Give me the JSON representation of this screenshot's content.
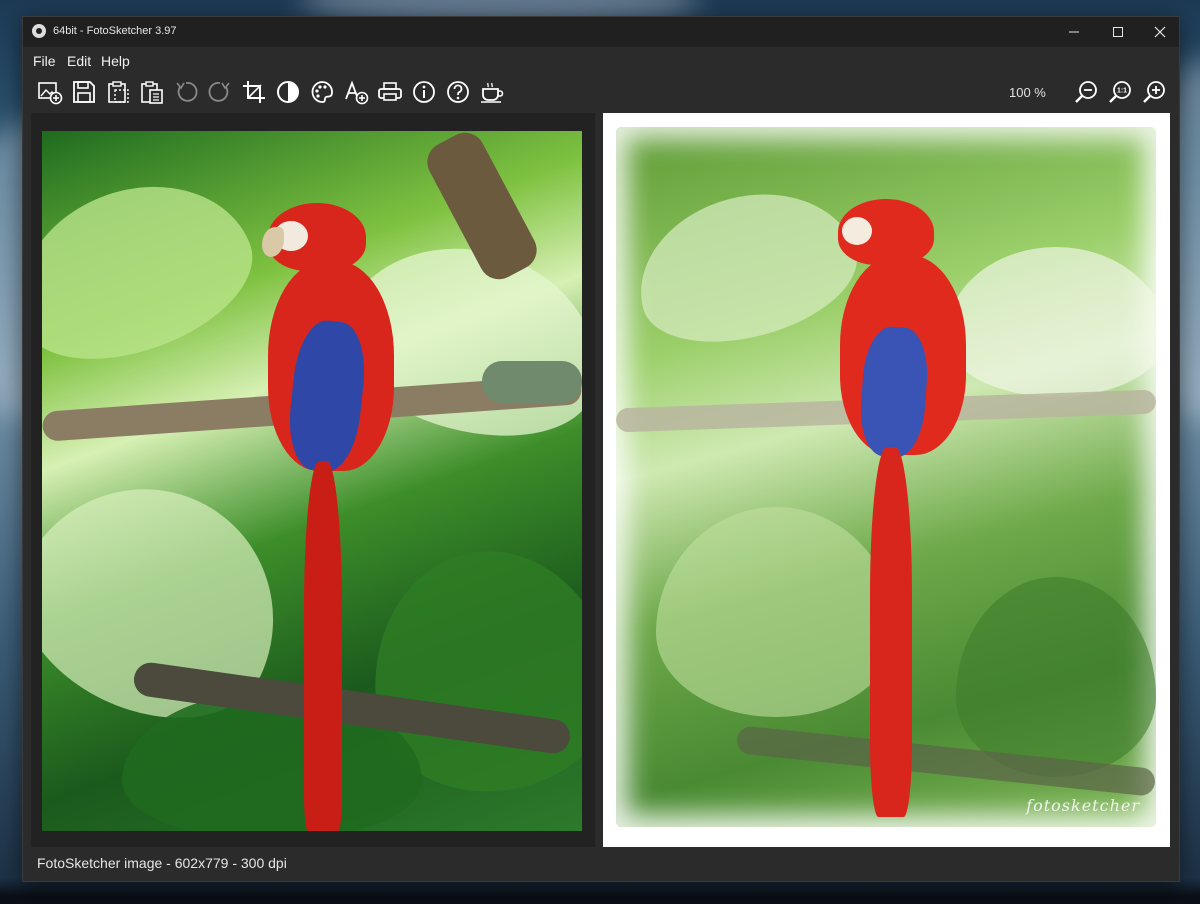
{
  "window": {
    "title": "64bit - FotoSketcher 3.97",
    "controls": [
      "minimize-icon",
      "maximize-icon",
      "close-icon"
    ]
  },
  "menu": {
    "items": [
      "File",
      "Edit",
      "Help"
    ]
  },
  "toolbar": {
    "buttons": [
      {
        "name": "open-image-button",
        "icon": "image-add-icon",
        "enabled": true
      },
      {
        "name": "save-button",
        "icon": "floppy-disk-icon",
        "enabled": true
      },
      {
        "name": "copy-button",
        "icon": "clipboard-copy-icon",
        "enabled": true
      },
      {
        "name": "paste-button",
        "icon": "clipboard-paste-icon",
        "enabled": true
      },
      {
        "name": "undo-button",
        "icon": "undo-icon",
        "enabled": false
      },
      {
        "name": "redo-button",
        "icon": "redo-icon",
        "enabled": false
      },
      {
        "name": "crop-button",
        "icon": "crop-icon",
        "enabled": true
      },
      {
        "name": "contrast-button",
        "icon": "contrast-icon",
        "enabled": true
      },
      {
        "name": "palette-button",
        "icon": "palette-icon",
        "enabled": true
      },
      {
        "name": "add-text-button",
        "icon": "text-add-icon",
        "enabled": true
      },
      {
        "name": "print-button",
        "icon": "printer-icon",
        "enabled": true
      },
      {
        "name": "info-button",
        "icon": "info-icon",
        "enabled": true
      },
      {
        "name": "help-button",
        "icon": "question-icon",
        "enabled": true
      },
      {
        "name": "donate-button",
        "icon": "coffee-cup-icon",
        "enabled": true
      }
    ],
    "zoom_level": "100 %",
    "zoom_buttons": [
      {
        "name": "zoom-out-button",
        "icon": "zoom-out-icon"
      },
      {
        "name": "zoom-actual-size-button",
        "icon": "zoom-1-1-icon",
        "label": "1:1"
      },
      {
        "name": "zoom-in-button",
        "icon": "zoom-in-icon"
      }
    ]
  },
  "canvas": {
    "sketch_signature": "fotosketcher"
  },
  "status": {
    "text": "FotoSketcher image - 602x779 - 300 dpi"
  },
  "colors": {
    "window_bg": "#2b2b2b",
    "titlebar_bg": "#202020",
    "icon_color": "#ffffff",
    "disabled_icon_color": "#8a8a8a",
    "parrot_red": "#d8261c",
    "parrot_blue": "#2f48a8"
  }
}
